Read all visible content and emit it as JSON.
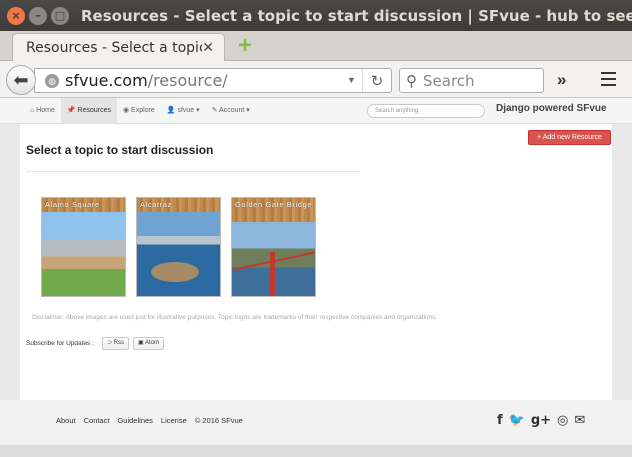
{
  "window": {
    "title": "Resources - Select a topic to start discussion | SFvue - hub to see San Francisco"
  },
  "tab": {
    "title": "Resources - Select a topic to start discussion",
    "close_glyph": "✕",
    "new_tab_glyph": "+"
  },
  "navbar": {
    "url_host": "sfvue.com",
    "url_path": "/resource/",
    "search_placeholder": "Search",
    "overflow_glyph": "»"
  },
  "site": {
    "nav": [
      {
        "label": "⌂ Home"
      },
      {
        "label": "📌 Resources"
      },
      {
        "label": "◉ Explore"
      },
      {
        "label": "👤 sfvue ▾"
      },
      {
        "label": "✎ Account ▾"
      }
    ],
    "search_placeholder": "Search anything",
    "brand": "Django powered SFvue"
  },
  "content": {
    "add_button": "+ Add new Resource",
    "title": "Select a topic to start discussion",
    "topics": [
      {
        "label": "Alamo Square"
      },
      {
        "label": "Alcatraz"
      },
      {
        "label": "Golden Gate Bridge"
      }
    ],
    "disclaimer": "Disclaimer: Above images are used just for illustrative purposes. Topic logos are trademarks of their respective companies and organizations.",
    "subscribe_label": "Subscribe for Updates :",
    "rss_label": "⊃ Rss",
    "atom_label": "▣ Atom"
  },
  "footer": {
    "links": [
      "About",
      "Contact",
      "Guidelines",
      "License",
      "© 2016 SFvue"
    ],
    "social": {
      "facebook": "f",
      "twitter": "🐦",
      "gplus": "g+",
      "github": "◎",
      "email": "✉"
    }
  },
  "colors": {
    "accent": "#d9534f",
    "titlebar": "#3c3b37",
    "close_button": "#f07746"
  }
}
